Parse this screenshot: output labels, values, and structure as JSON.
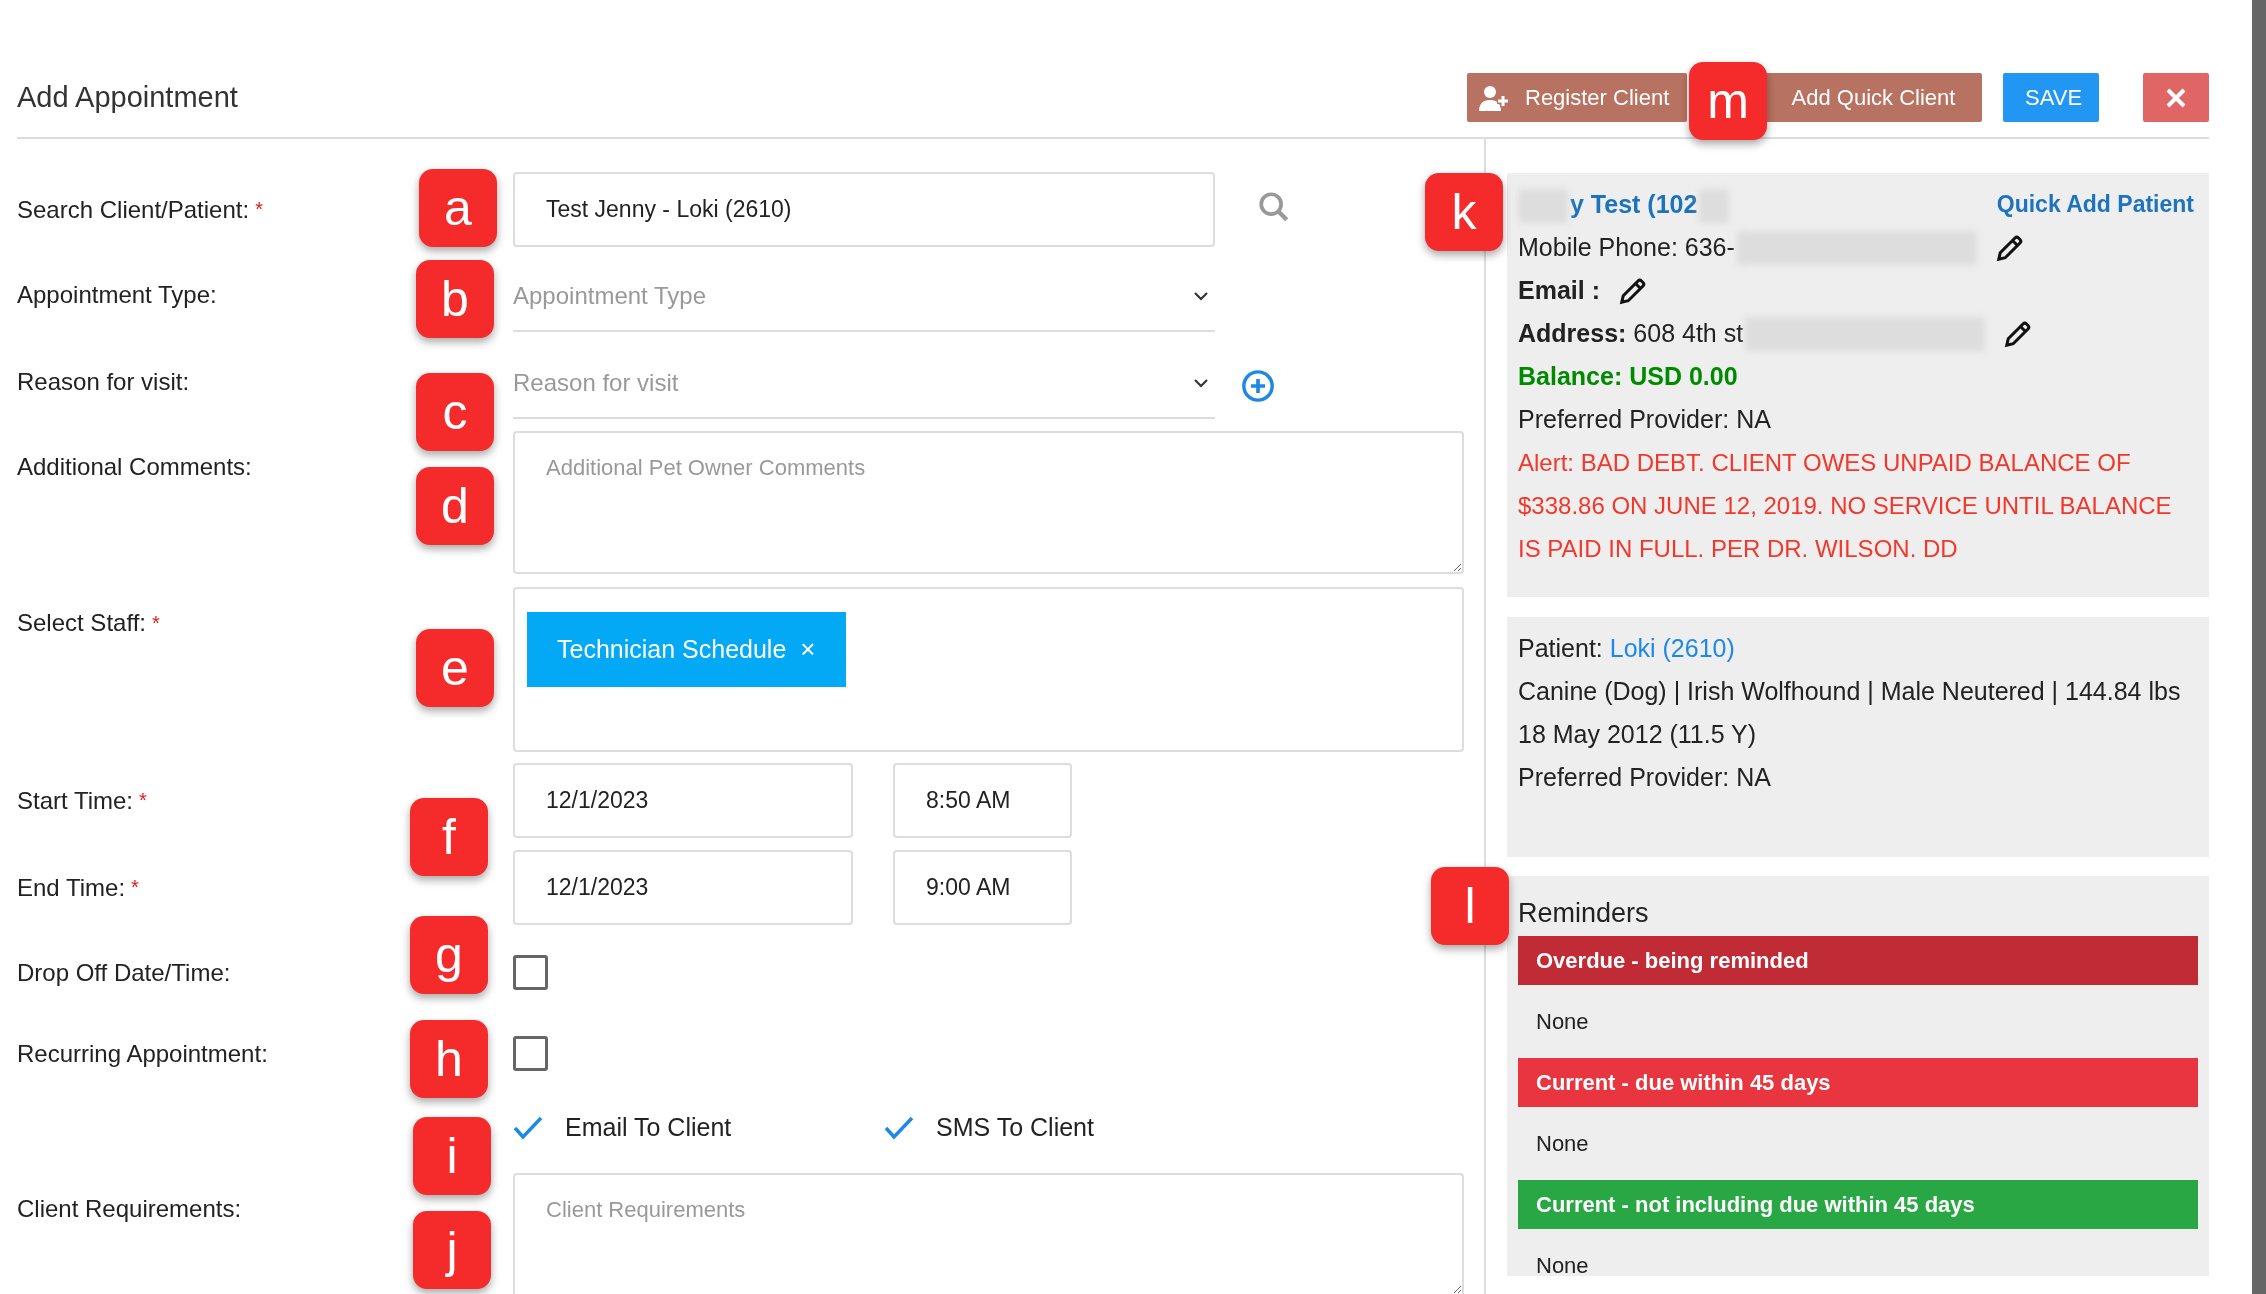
{
  "dialog": {
    "title": "Add Appointment",
    "buttons": [
      {
        "kind": "register",
        "label": "Register Client"
      },
      {
        "kind": "quick",
        "label": "Add Quick Client"
      },
      {
        "kind": "save",
        "label": "SAVE"
      },
      {
        "kind": "close"
      }
    ]
  },
  "form": {
    "rows": [
      {
        "kind": "search",
        "label": "Search Client/Patient:",
        "required_mark": "*",
        "value": "Test Jenny - Loki (2610)"
      },
      {
        "kind": "select",
        "label": "Appointment Type:",
        "placeholder": "Appointment Type",
        "add_button": false
      },
      {
        "kind": "select",
        "label": "Reason for visit:",
        "placeholder": "Reason for visit",
        "add_button": true
      },
      {
        "kind": "textarea",
        "label": "Additional Comments:",
        "placeholder": "Additional Pet Owner Comments"
      },
      {
        "kind": "tags",
        "label": "Select Staff:",
        "required_mark": "*",
        "tags": [
          {
            "label": "Technician Schedule",
            "remove": "×"
          }
        ]
      },
      {
        "kind": "datetime",
        "label": "Start Time:",
        "required_mark": "*",
        "date": "12/1/2023",
        "time": "8:50 AM"
      },
      {
        "kind": "datetime",
        "label": "End Time:",
        "required_mark": "*",
        "date": "12/1/2023",
        "time": "9:00 AM"
      },
      {
        "kind": "checkbox",
        "label": "Drop Off Date/Time:",
        "checked": false
      },
      {
        "kind": "checkbox",
        "label": "Recurring Appointment:",
        "checked": false
      },
      {
        "kind": "notify",
        "options": [
          {
            "label": "Email To Client",
            "checked": true
          },
          {
            "label": "SMS To Client",
            "checked": true
          }
        ]
      },
      {
        "kind": "textarea",
        "label": "Client Requirements:",
        "placeholder": "Client Requirements"
      }
    ]
  },
  "client_card": {
    "name": "y Test (102",
    "name_redacted": true,
    "quick_add": "Quick Add Patient",
    "lines": [
      {
        "kind": "contact",
        "text": "Mobile Phone: 636-",
        "bold": false,
        "redacted": true,
        "editable": true
      },
      {
        "kind": "contact",
        "text": "Email :",
        "bold": true,
        "redacted": false,
        "editable": true
      },
      {
        "kind": "contact",
        "text": "**Address:** 608 4th st",
        "bold": false,
        "redacted": true,
        "editable": true
      },
      {
        "kind": "balance",
        "text": "Balance: USD 0.00"
      },
      {
        "kind": "plain",
        "text": "Preferred Provider: NA"
      },
      {
        "kind": "alert",
        "text": "Alert: BAD DEBT. CLIENT OWES UNPAID BALANCE OF $338.86 ON JUNE 12, 2019. NO SERVICE UNTIL BALANCE IS PAID IN FULL. PER DR. WILSON. DD"
      }
    ]
  },
  "patient_card": {
    "label": "Patient:",
    "name": "Loki (2610)",
    "lines": [
      "Canine (Dog) | Irish Wolfhound | Male Neutered | 144.84 lbs",
      "18 May 2012 (11.5 Y)",
      "Preferred Provider: NA"
    ]
  },
  "reminders": {
    "title": "Reminders",
    "groups": [
      {
        "label": "Overdue - being reminded",
        "color": "#c12b36",
        "items": [
          "None"
        ]
      },
      {
        "label": "Current - due within 45 days",
        "color": "#e8353f",
        "items": [
          "None"
        ]
      },
      {
        "label": "Current - not including due within 45 days",
        "color": "#2aa745",
        "items": [
          "None"
        ]
      }
    ]
  },
  "markers": [
    "a",
    "b",
    "c",
    "d",
    "e",
    "f",
    "g",
    "h",
    "i",
    "j",
    "k",
    "l",
    "m"
  ]
}
